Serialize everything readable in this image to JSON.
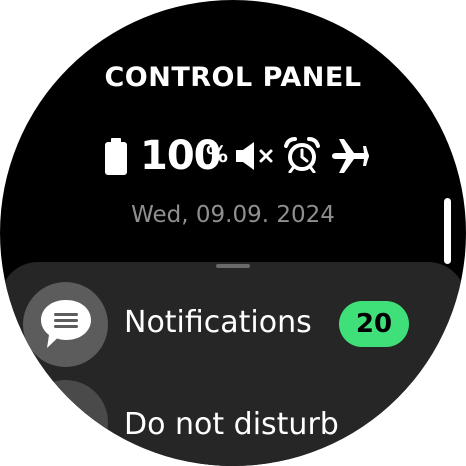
{
  "header": {
    "title": "CONTROL PANEL"
  },
  "status": {
    "battery_percent": "100",
    "percent_sign": "%",
    "icons": [
      "battery-full-icon",
      "volume-muted-icon",
      "alarm-clock-icon",
      "airplane-icon"
    ]
  },
  "date": "Wed, 09.09. 2024",
  "menu": {
    "items": [
      {
        "label": "Notifications",
        "icon": "chat-bubble-icon",
        "badge": "20"
      },
      {
        "label": "Do not disturb",
        "icon": "moon-icon"
      }
    ]
  },
  "colors": {
    "background": "#000000",
    "panel": "#262626",
    "badge": "#3fe07a",
    "date_text": "#8f8f8f",
    "icon_circle": "#5c5c5c"
  }
}
